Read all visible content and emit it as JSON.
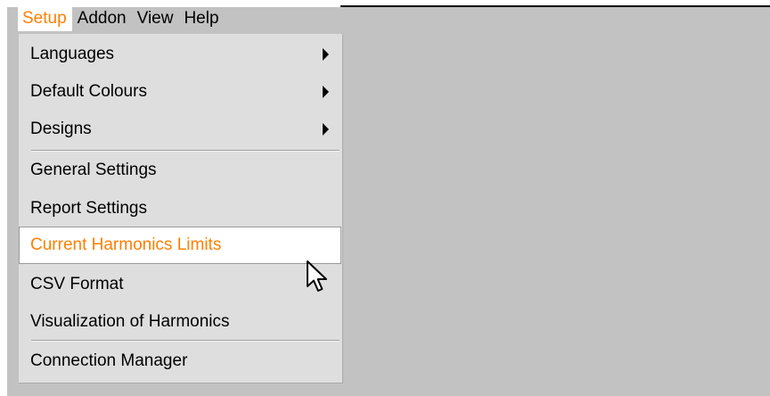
{
  "menubar": {
    "items": [
      {
        "label": "Setup"
      },
      {
        "label": "Addon"
      },
      {
        "label": "View"
      },
      {
        "label": "Help"
      }
    ]
  },
  "setup_menu": {
    "items": [
      {
        "label": "Languages",
        "has_submenu": true
      },
      {
        "label": "Default Colours",
        "has_submenu": true
      },
      {
        "label": "Designs",
        "has_submenu": true
      },
      {
        "label": "General Settings"
      },
      {
        "label": "Report Settings"
      },
      {
        "label": "Current Harmonics Limits",
        "highlighted": true
      },
      {
        "label": "CSV Format"
      },
      {
        "label": "Visualization of Harmonics"
      },
      {
        "label": "Connection Manager"
      }
    ]
  },
  "colors": {
    "accent": "#ff7f00",
    "menu_background": "#dedede",
    "backdrop": "#c2c2c2",
    "highlight_background": "#ffffff"
  },
  "icons": {
    "submenu": "triangle-right-icon",
    "pointer": "mouse-cursor-icon"
  }
}
